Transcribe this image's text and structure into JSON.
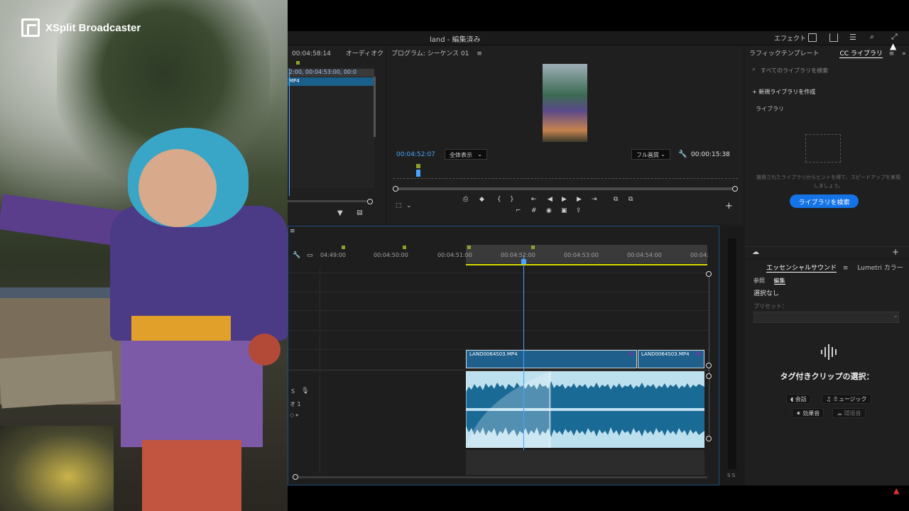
{
  "overlay": {
    "brand": "XSplit Broadcaster"
  },
  "titlebar": {
    "title": "land - 編集済み",
    "effects": "エフェクト"
  },
  "source": {
    "timecode": "00:04:58:14",
    "tab": "オーディオク",
    "ruler": "2:00, 00:04:53:00, 00:0",
    "item": "MP4"
  },
  "program": {
    "title": "プログラム: シーケンス 01",
    "timecode": "00:04:52:07",
    "zoom": "全体表示",
    "quality": "フル画質",
    "duration": "00:00:15:38"
  },
  "library": {
    "tab1": "ラフィックテンプレート",
    "tab2": "CC ライブラリ",
    "search_placeholder": "すべてのライブラリを検索",
    "new_library": "新規ライブラリを作成",
    "libraries": "ライブラリ",
    "hint": "推奨されたライブラリからヒントを得て、スピードアップを実現しましょう。",
    "browse": "ライブラリを検索"
  },
  "sound": {
    "tab1": "エッセンシャルサウンド",
    "tab2": "Lumetri カラー",
    "browse": "参照",
    "edit": "編集",
    "none": "選択なし",
    "preset": "プリセット：",
    "heading": "タグ付きクリップの選択：",
    "tags": [
      "会話",
      "ミュージック",
      "効果音",
      "環境音"
    ]
  },
  "timeline": {
    "ticks": [
      "04:49:00",
      "00:04:50:00",
      "00:04:51:00",
      "00:04:52:00",
      "00:04:53:00",
      "00:04:54:00",
      "00:04:"
    ],
    "clip1": "LAND0064S03.MP4",
    "clip2": "LAND0064S03.MP4",
    "fx": "fx",
    "track_s": "S",
    "track_a1": "オ 1"
  },
  "meter": {
    "label": "S S"
  }
}
